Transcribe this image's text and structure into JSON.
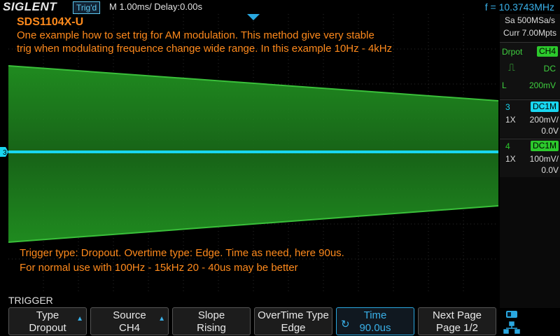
{
  "header": {
    "brand": "SIGLENT",
    "trig_status": "Trig'd",
    "timebase": "M 1.00ms/ Delay:0.00s",
    "frequency": "f = 10.3743MHz"
  },
  "annotations": {
    "title": "SDS1104X-U",
    "line1": "One example how to set trig for AM modulation. This method give very stable",
    "line2": "trig when modulating frequence change wide range. In this example  10Hz - 4kHz",
    "line3": "Trigger type: Dropout. Overtime type: Edge. Time as need, here 90us.",
    "line4": "For normal use with 100Hz  - 15kHz  20 - 40us may be better"
  },
  "right_panel": {
    "sample_rate": "Sa 500MSa/s",
    "memory": "Curr 7.00Mpts",
    "trigger": {
      "mode_label": "Drpot",
      "source": "CH4",
      "coupling": "DC",
      "level_prefix": "L",
      "level": "200mV"
    },
    "ch3": {
      "num": "3",
      "coupling": "DC1M",
      "probe": "1X",
      "scale": "200mV/",
      "offset": "0.0V"
    },
    "ch4": {
      "num": "4",
      "coupling": "DC1M",
      "probe": "1X",
      "scale": "100mV/",
      "offset": "0.0V"
    }
  },
  "channel_marker": "3",
  "menu": {
    "title": "TRIGGER",
    "softkeys": [
      {
        "line1": "Type",
        "line2": "Dropout"
      },
      {
        "line1": "Source",
        "line2": "CH4"
      },
      {
        "line1": "Slope",
        "line2": "Rising"
      },
      {
        "line1": "OverTime Type",
        "line2": "Edge"
      },
      {
        "line1": "Time",
        "line2": "90.0us"
      },
      {
        "line1": "Next Page",
        "line2": "Page 1/2"
      }
    ]
  },
  "colors": {
    "ch3": "#19d6f0",
    "ch4_envelope": "#1f8a1f",
    "annotation": "#ff8a1c",
    "accent": "#2aa8e0"
  }
}
